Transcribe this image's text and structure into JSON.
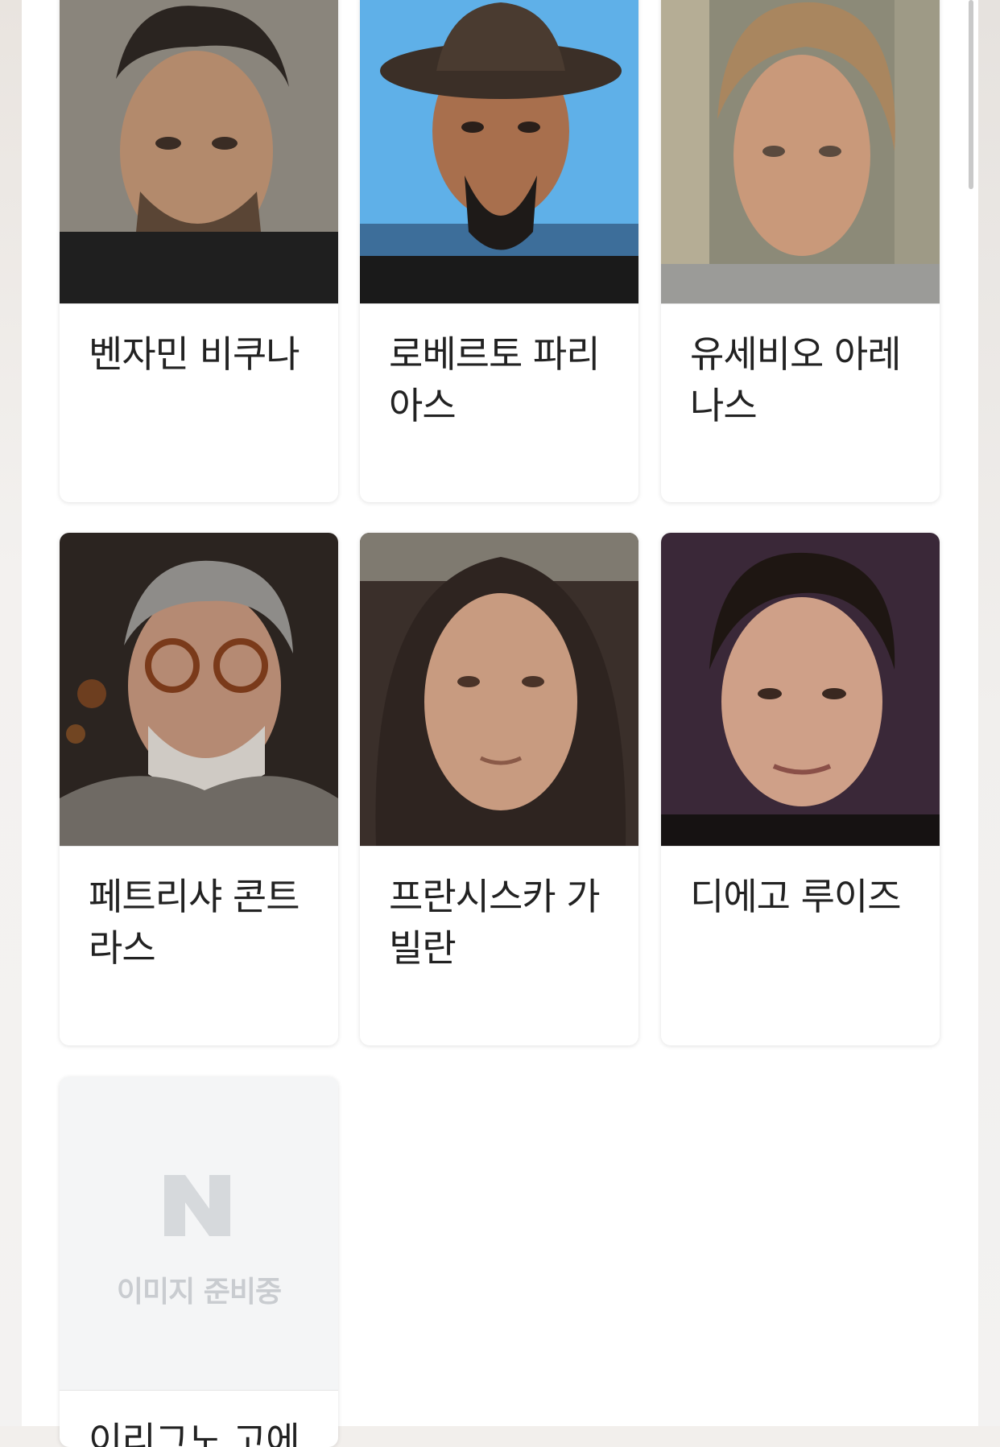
{
  "cast": [
    {
      "name": "벤자민 비쿠나"
    },
    {
      "name": "로베르토 파리아스"
    },
    {
      "name": "유세비오 아레나스"
    },
    {
      "name": "페트리샤 콘트라스"
    },
    {
      "name": "프란시스카 가빌란"
    },
    {
      "name": "디에고 루이즈"
    },
    {
      "name": "이리그노 고에"
    }
  ],
  "placeholder": {
    "text": "이미지 준비중"
  }
}
